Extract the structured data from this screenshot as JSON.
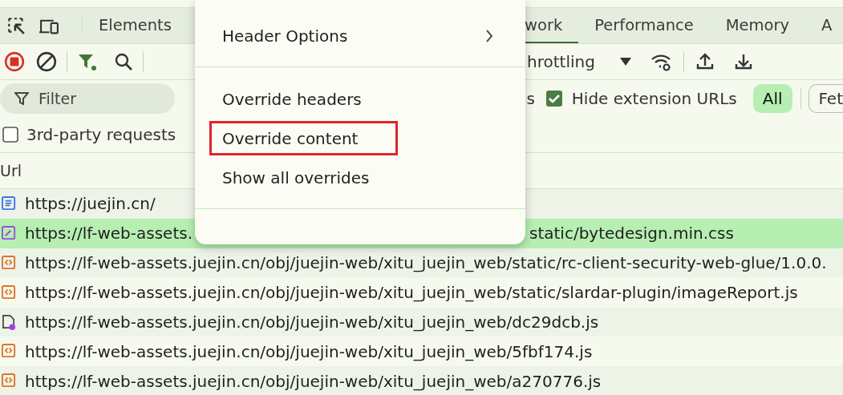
{
  "tabs": [
    {
      "label": "Elements",
      "selected": false
    },
    {
      "label": "work",
      "selected": true
    },
    {
      "label": "Performance",
      "selected": false
    },
    {
      "label": "Memory",
      "selected": false
    },
    {
      "label": "A",
      "selected": false
    }
  ],
  "toolbar": {
    "recording": true,
    "throttling": "hrottling"
  },
  "filter": {
    "placeholder": "Filter",
    "partial_label": "s",
    "hide_extension_urls": {
      "label": "Hide extension URLs",
      "checked": true
    },
    "types": [
      {
        "label": "All",
        "selected": true
      },
      {
        "label": "Fet",
        "selected": false
      }
    ]
  },
  "third_party": {
    "label": "3rd-party requests",
    "checked": false
  },
  "table": {
    "columns": [
      "Url"
    ],
    "rows": [
      {
        "kind": "document",
        "url": "https://juejin.cn/",
        "selected": false
      },
      {
        "kind": "stylesheet",
        "url": "https://lf-web-assets.",
        "url_end": "static/bytedesign.min.css",
        "selected": true
      },
      {
        "kind": "script",
        "url": "https://lf-web-assets.juejin.cn/obj/juejin-web/xitu_juejin_web/static/rc-client-security-web-glue/1.0.0.",
        "selected": false
      },
      {
        "kind": "script",
        "url": "https://lf-web-assets.juejin.cn/obj/juejin-web/xitu_juejin_web/static/slardar-plugin/imageReport.js",
        "selected": false
      },
      {
        "kind": "file",
        "url": "https://lf-web-assets.juejin.cn/obj/juejin-web/xitu_juejin_web/dc29dcb.js",
        "selected": false
      },
      {
        "kind": "script",
        "url": "https://lf-web-assets.juejin.cn/obj/juejin-web/xitu_juejin_web/5fbf174.js",
        "selected": false
      },
      {
        "kind": "script",
        "url": "https://lf-web-assets.juejin.cn/obj/juejin-web/xitu_juejin_web/a270776.js",
        "selected": false
      }
    ]
  },
  "context_menu": {
    "items": [
      {
        "label": "Header Options",
        "submenu": true,
        "highlighted": false
      },
      {
        "kind": "divider"
      },
      {
        "label": "Override headers",
        "submenu": false,
        "highlighted": false
      },
      {
        "label": "Override content",
        "submenu": false,
        "highlighted": true
      },
      {
        "label": "Show all overrides",
        "submenu": false,
        "highlighted": false
      },
      {
        "kind": "divider"
      }
    ]
  }
}
